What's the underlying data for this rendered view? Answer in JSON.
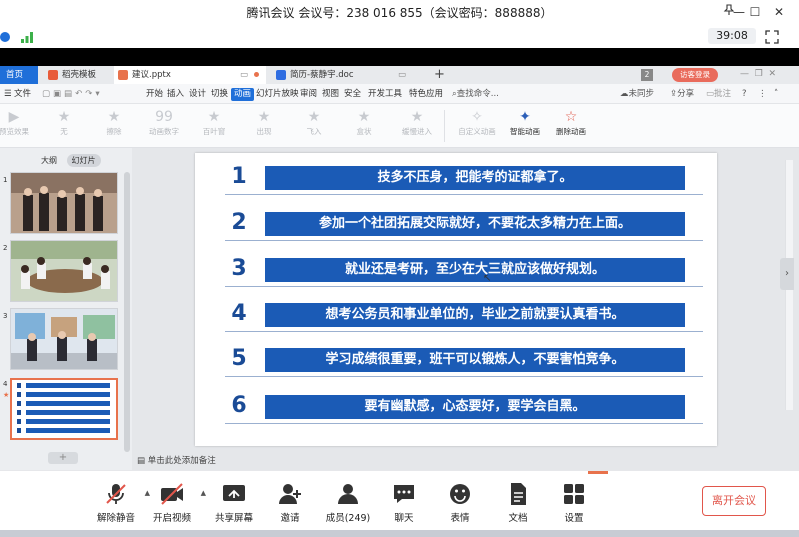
{
  "meeting": {
    "title": "腾讯会议 会议号：238 016 855（会议密码：888888）",
    "timer": "39:08",
    "win_min": "—",
    "win_max": "☐",
    "win_close": "✕"
  },
  "wps": {
    "tabs": [
      {
        "label": "首页"
      },
      {
        "label": "稻壳模板"
      },
      {
        "label": "建议.pptx"
      },
      {
        "label": "简历-蔡静宇.doc"
      }
    ],
    "tab_count": "2",
    "login_label": "访客登录",
    "menu": [
      "文件",
      "开始",
      "插入",
      "设计",
      "切换",
      "动画",
      "幻灯片放映",
      "审阅",
      "视图",
      "安全",
      "开发工具",
      "特色应用"
    ],
    "search_label": "查找命令...",
    "sync_label": "未同步",
    "share_label": "分享",
    "comment_label": "批注",
    "ribbon": {
      "preview": "预览效果",
      "effects": [
        "无",
        "擦除",
        "动画数字",
        "百叶窗",
        "出现",
        "飞入",
        "盒状",
        "缓慢进入"
      ],
      "custom": "自定义动画",
      "smart": "智能动画",
      "delete": "删除动画"
    },
    "panel_tabs": [
      "大纲",
      "幻灯片"
    ],
    "thumb_numbers": [
      "1",
      "2",
      "3",
      "4"
    ],
    "notes_hint": "单击此处添加备注"
  },
  "slide": {
    "items": [
      {
        "num": "1",
        "text": "技多不压身，把能考的证都拿了。"
      },
      {
        "num": "2",
        "text": "参加一个社团拓展交际就好，不要花太多精力在上面。"
      },
      {
        "num": "3",
        "text": "就业还是考研，至少在大三就应该做好规划。"
      },
      {
        "num": "4",
        "text": "想考公务员和事业单位的，毕业之前就要认真看书。"
      },
      {
        "num": "5",
        "text": "学习成绩很重要，班干可以锻炼人，不要害怕竞争。"
      },
      {
        "num": "6",
        "text": "要有幽默感，心态要好，要学会自黑。"
      }
    ]
  },
  "toolbar": {
    "mute": "解除静音",
    "video": "开启视频",
    "share": "共享屏幕",
    "invite": "邀请",
    "members": "成员(249)",
    "chat": "聊天",
    "reaction": "表情",
    "docs": "文档",
    "settings": "设置",
    "leave": "离开会议"
  },
  "colors": {
    "accent": "#1f6fd9",
    "slide_bar": "#1b5bb6",
    "slide_num": "#1a4b96",
    "leave": "#e1564b"
  }
}
